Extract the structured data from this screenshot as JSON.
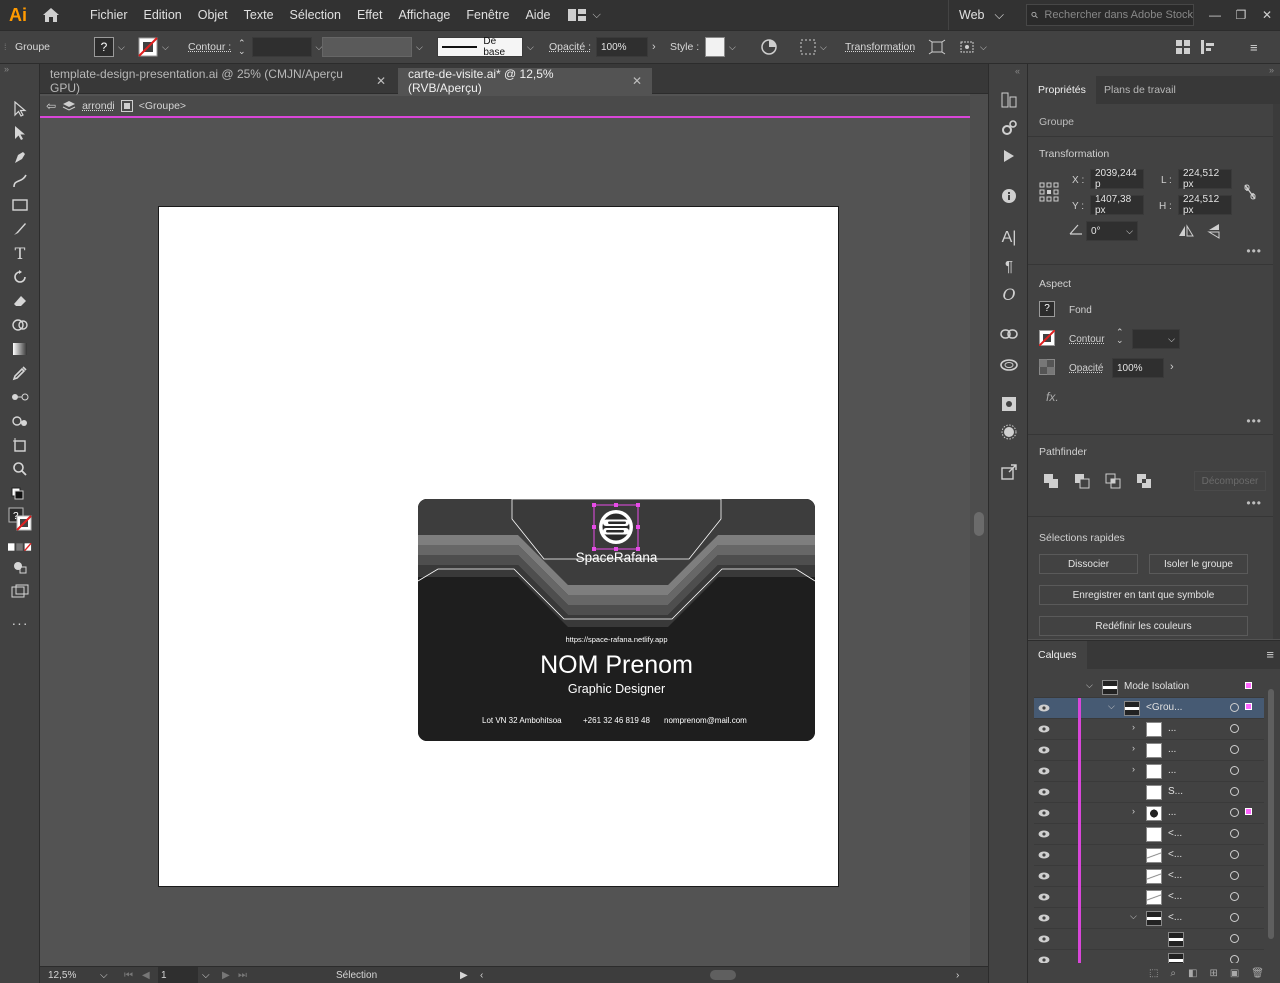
{
  "app": {
    "logo": "Ai",
    "accent": "#ff9a00",
    "isolation_color": "#d946d9"
  },
  "menu": [
    "Fichier",
    "Edition",
    "Objet",
    "Texte",
    "Sélection",
    "Effet",
    "Affichage",
    "Fenêtre",
    "Aide"
  ],
  "workspace": {
    "name": "Web",
    "search_placeholder": "Rechercher dans Adobe Stock"
  },
  "controlbar": {
    "object_type": "Groupe",
    "fill_symbol": "?",
    "stroke_label": "Contour :",
    "stroke_profile": "De base",
    "opacity_label": "Opacité :",
    "opacity_value": "100%",
    "style_label": "Style :",
    "transform_label": "Transformation"
  },
  "tabs": [
    {
      "label": "template-design-presentation.ai @ 25% (CMJN/Aperçu GPU)",
      "active": false
    },
    {
      "label": "carte-de-visite.ai* @ 12,5% (RVB/Aperçu)",
      "active": true
    }
  ],
  "isolation": {
    "layer": "arrondi",
    "group": "<Groupe>"
  },
  "card": {
    "brand": "SpaceRafana",
    "url": "https://space-rafana.netlify.app",
    "name": "NOM Prenom",
    "job": "Graphic Designer",
    "address": "Lot VN 32 Ambohitsoa",
    "phone": "+261 32 46 819 48",
    "email": "nomprenom@mail.com"
  },
  "statusbar": {
    "zoom": "12,5%",
    "artboard_index": "1",
    "tool": "Sélection"
  },
  "properties": {
    "tabs": [
      "Propriétés",
      "Plans de travail"
    ],
    "selection_type": "Groupe",
    "transform": {
      "title": "Transformation",
      "x_label": "X :",
      "x": "2039,244 p",
      "y_label": "Y :",
      "y": "1407,38 px",
      "w_label": "L :",
      "w": "224,512 px",
      "h_label": "H :",
      "h": "224,512 px",
      "angle": "0°"
    },
    "appearance": {
      "title": "Aspect",
      "fill_label": "Fond",
      "stroke_label": "Contour",
      "opacity_label": "Opacité",
      "opacity_value": "100%",
      "fx": "fx."
    },
    "pathfinder": {
      "title": "Pathfinder",
      "expand": "Décomposer"
    },
    "quick_actions": {
      "title": "Sélections rapides",
      "ungroup": "Dissocier",
      "isolate": "Isoler le groupe",
      "save_symbol": "Enregistrer en tant que symbole",
      "recolor": "Redéfinir les couleurs"
    }
  },
  "layers": {
    "title": "Calques",
    "rows": [
      {
        "name": "Mode Isolation",
        "indent": 0,
        "expand": "open",
        "thumb": "dark",
        "sel": false
      },
      {
        "name": "<Grou...",
        "indent": 1,
        "expand": "open",
        "thumb": "dark",
        "sel": true
      },
      {
        "name": "...",
        "indent": 2,
        "expand": "closed",
        "thumb": "white",
        "sel": false
      },
      {
        "name": "...",
        "indent": 2,
        "expand": "closed",
        "thumb": "white",
        "sel": false
      },
      {
        "name": "...",
        "indent": 2,
        "expand": "closed",
        "thumb": "white",
        "sel": false
      },
      {
        "name": "S...",
        "indent": 2,
        "expand": "none",
        "thumb": "white",
        "sel": false
      },
      {
        "name": "...",
        "indent": 2,
        "expand": "closed",
        "thumb": "logo",
        "sel": false
      },
      {
        "name": "<...",
        "indent": 2,
        "expand": "none",
        "thumb": "white",
        "sel": false
      },
      {
        "name": "<...",
        "indent": 2,
        "expand": "none",
        "thumb": "wave",
        "sel": false
      },
      {
        "name": "<...",
        "indent": 2,
        "expand": "none",
        "thumb": "wave",
        "sel": false
      },
      {
        "name": "<...",
        "indent": 2,
        "expand": "none",
        "thumb": "wave",
        "sel": false
      },
      {
        "name": "<...",
        "indent": 2,
        "expand": "open",
        "thumb": "dark",
        "sel": false
      },
      {
        "name": "",
        "indent": 3,
        "expand": "none",
        "thumb": "dark",
        "sel": false
      },
      {
        "name": "",
        "indent": 3,
        "expand": "none",
        "thumb": "dark",
        "sel": false
      }
    ]
  }
}
